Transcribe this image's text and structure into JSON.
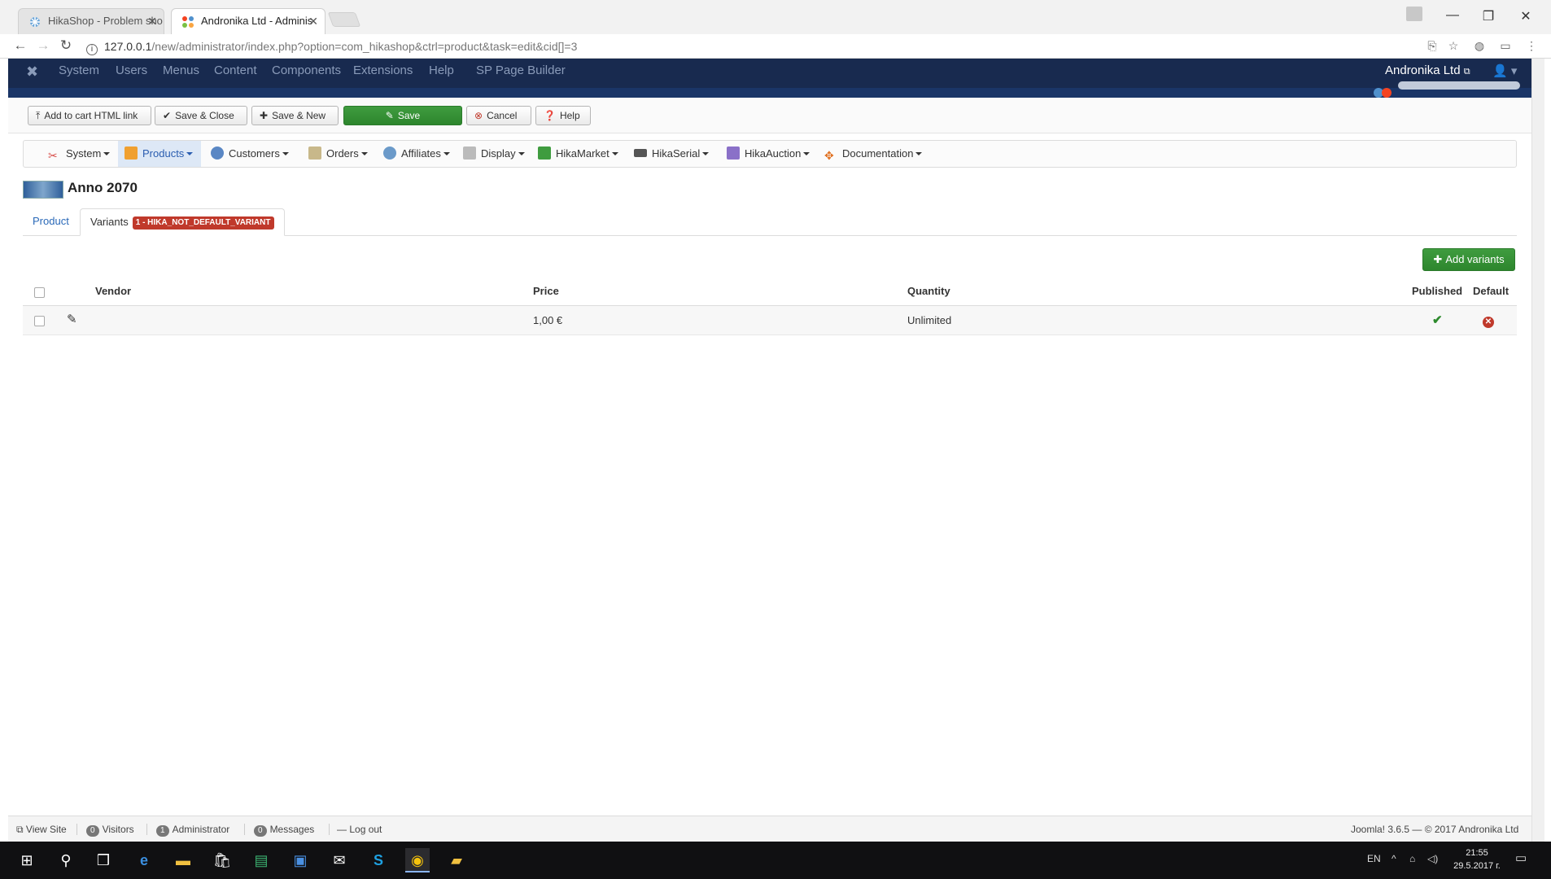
{
  "browser": {
    "tabs": [
      {
        "title": "HikaShop - Problem sho",
        "active": false
      },
      {
        "title": "Andronika Ltd - Adminis",
        "active": true
      }
    ],
    "url_host": "127.0.0.1",
    "url_path": "/new/administrator/index.php?option=com_hikashop&ctrl=product&task=edit&cid[]=3"
  },
  "topnav": {
    "items": [
      "System",
      "Users",
      "Menus",
      "Content",
      "Components",
      "Extensions",
      "Help",
      "SP Page Builder"
    ],
    "site_name": "Andronika Ltd"
  },
  "toolbar": {
    "add_to_cart_label": "Add to cart HTML link",
    "save_close_label": "Save & Close",
    "save_new_label": "Save & New",
    "save_label": "Save",
    "cancel_label": "Cancel",
    "help_label": "Help"
  },
  "hikamenu": {
    "items": [
      "System",
      "Products",
      "Customers",
      "Orders",
      "Affiliates",
      "Display",
      "HikaMarket",
      "HikaSerial",
      "HikaAuction",
      "Documentation"
    ]
  },
  "product": {
    "title": "Anno 2070"
  },
  "tabs": {
    "product_label": "Product",
    "variants_label": "Variants",
    "variants_badge": "1 - HIKA_NOT_DEFAULT_VARIANT"
  },
  "add_variants_label": "Add variants",
  "table": {
    "headers": {
      "vendor": "Vendor",
      "price": "Price",
      "quantity": "Quantity",
      "published": "Published",
      "default": "Default"
    },
    "rows": [
      {
        "vendor": "",
        "price": "1,00 €",
        "quantity": "Unlimited",
        "published": true,
        "default": false
      }
    ]
  },
  "statusbar": {
    "view_site": "View Site",
    "visitors_count": "0",
    "visitors_label": "Visitors",
    "admin_count": "1",
    "admin_label": "Administrator",
    "messages_count": "0",
    "messages_label": "Messages",
    "logout_label": "Log out",
    "copyright": "Joomla! 3.6.5 — © 2017 Andronika Ltd"
  },
  "taskbar": {
    "language": "EN",
    "time": "21:55",
    "date": "29.5.2017 г."
  },
  "colors": {
    "joomla_nav": "#182a4f",
    "save_green": "#2d862d",
    "badge_red": "#c0392b",
    "link_blue": "#2a69b8"
  }
}
